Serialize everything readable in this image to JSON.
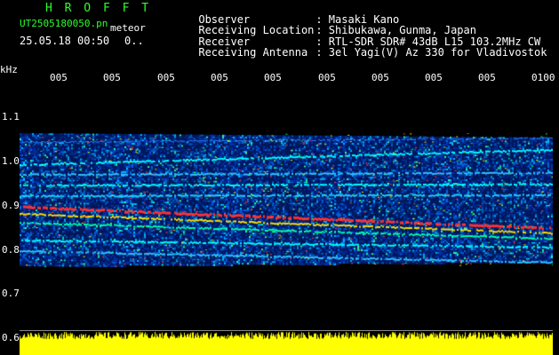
{
  "app": {
    "title": "H R O F F T",
    "file_name": "UT2505180050.pn",
    "mode": "meteor",
    "date_time": "25.05.18 00:50",
    "counter": "0.."
  },
  "meta": [
    {
      "label": "Observer",
      "value": ": Masaki Kano"
    },
    {
      "label": "Receiving Location",
      "value": ": Shibukawa, Gunma, Japan"
    },
    {
      "label": "Receiver",
      "value": ": RTL-SDR SDR# 43dB L15 103.2MHz CW"
    },
    {
      "label": "Receiving Antenna",
      "value": ": 3el Yagi(V) Az 330 for Vladivostok"
    }
  ],
  "axes": {
    "unit": "kHz",
    "time_ticks": [
      "005",
      "005",
      "005",
      "005",
      "005",
      "005",
      "005",
      "005",
      "005",
      "0100"
    ],
    "freq_ticks": [
      "1.1",
      "1.0",
      "0.9",
      "0.8",
      "0.7",
      "0.6"
    ]
  },
  "colors": {
    "title": "#2bff2b",
    "background": "#000000",
    "signal": "#ffff00",
    "hot_band": "#ff3030"
  }
}
